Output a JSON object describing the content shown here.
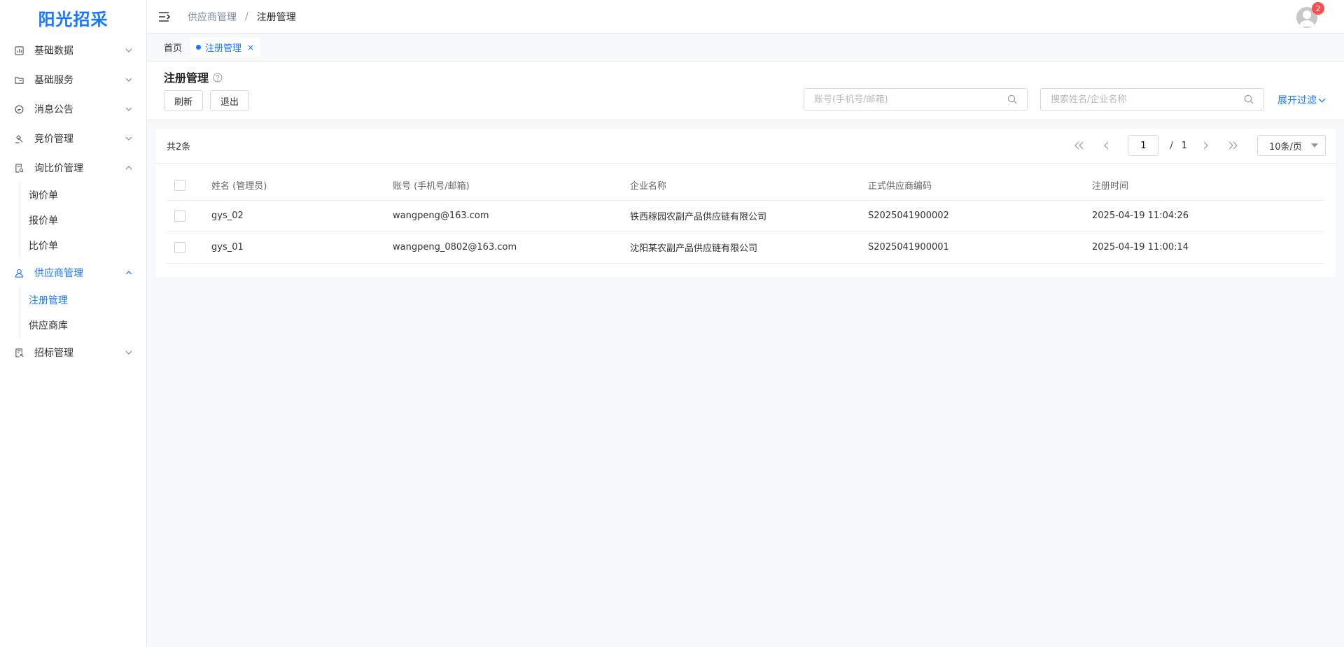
{
  "app": {
    "logo": "阳光招采"
  },
  "sidebar": {
    "items": [
      {
        "label": "基础数据",
        "icon": "chart-icon",
        "expanded": false
      },
      {
        "label": "基础服务",
        "icon": "folder-icon",
        "expanded": false
      },
      {
        "label": "消息公告",
        "icon": "message-icon",
        "expanded": false
      },
      {
        "label": "竞价管理",
        "icon": "gavel-icon",
        "expanded": false
      },
      {
        "label": "询比价管理",
        "icon": "doc-search-icon",
        "expanded": true,
        "children": [
          {
            "label": "询价单"
          },
          {
            "label": "报价单"
          },
          {
            "label": "比价单"
          }
        ]
      },
      {
        "label": "供应商管理",
        "icon": "user-icon",
        "expanded": true,
        "children": [
          {
            "label": "注册管理",
            "active": true
          },
          {
            "label": "供应商库"
          }
        ]
      },
      {
        "label": "招标管理",
        "icon": "bid-icon",
        "expanded": false
      }
    ]
  },
  "header": {
    "breadcrumb": {
      "parent": "供应商管理",
      "separator": "/",
      "current": "注册管理"
    },
    "notifications": "2"
  },
  "tabs": [
    {
      "label": "首页",
      "active": false
    },
    {
      "label": "注册管理",
      "active": true,
      "close": "×"
    }
  ],
  "page": {
    "title": "注册管理",
    "buttons": {
      "refresh": "刷新",
      "exit": "退出"
    },
    "search_account_placeholder": "账号(手机号/邮箱)",
    "search_name_placeholder": "搜索姓名/企业名称",
    "expand_filter": "展开过滤"
  },
  "list": {
    "total": "共2条",
    "pagination": {
      "current": "1",
      "separator": "/",
      "total_pages": "1",
      "page_size": "10条/页"
    },
    "columns": [
      "姓名 (管理员)",
      "账号 (手机号/邮箱)",
      "企业名称",
      "正式供应商编码",
      "注册时间"
    ],
    "rows": [
      {
        "name": "gys_02",
        "account": "wangpeng@163.com",
        "company": "铁西稼园农副产品供应链有限公司",
        "code": "S2025041900002",
        "time": "2025-04-19 11:04:26"
      },
      {
        "name": "gys_01",
        "account": "wangpeng_0802@163.com",
        "company": "沈阳某农副产品供应链有限公司",
        "code": "S2025041900001",
        "time": "2025-04-19 11:00:14"
      }
    ]
  },
  "colors": {
    "primary": "#1677ff",
    "badge": "#ff4d4f"
  }
}
